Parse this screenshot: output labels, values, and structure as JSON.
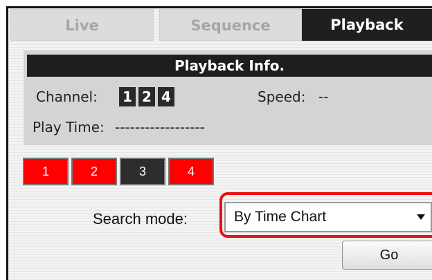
{
  "tabs": [
    {
      "label": "Live"
    },
    {
      "label": "Sequence"
    },
    {
      "label": "Playback"
    }
  ],
  "playback_info": {
    "title": "Playback Info.",
    "channel_label": "Channel:",
    "channels": [
      "1",
      "2",
      "4"
    ],
    "speed_label": "Speed:",
    "speed_value": "--",
    "play_time_label": "Play Time:",
    "play_time_value": "------------------"
  },
  "cameras": [
    {
      "label": "1",
      "state": "on"
    },
    {
      "label": "2",
      "state": "on"
    },
    {
      "label": "3",
      "state": "off"
    },
    {
      "label": "4",
      "state": "on"
    }
  ],
  "search": {
    "label": "Search mode:",
    "selected": "By Time Chart"
  },
  "go_label": "Go",
  "colors": {
    "active_tab": "#1f1f1f",
    "camera_on": "#ff0000",
    "camera_off": "#2d2d2d",
    "highlight": "#e81010"
  }
}
